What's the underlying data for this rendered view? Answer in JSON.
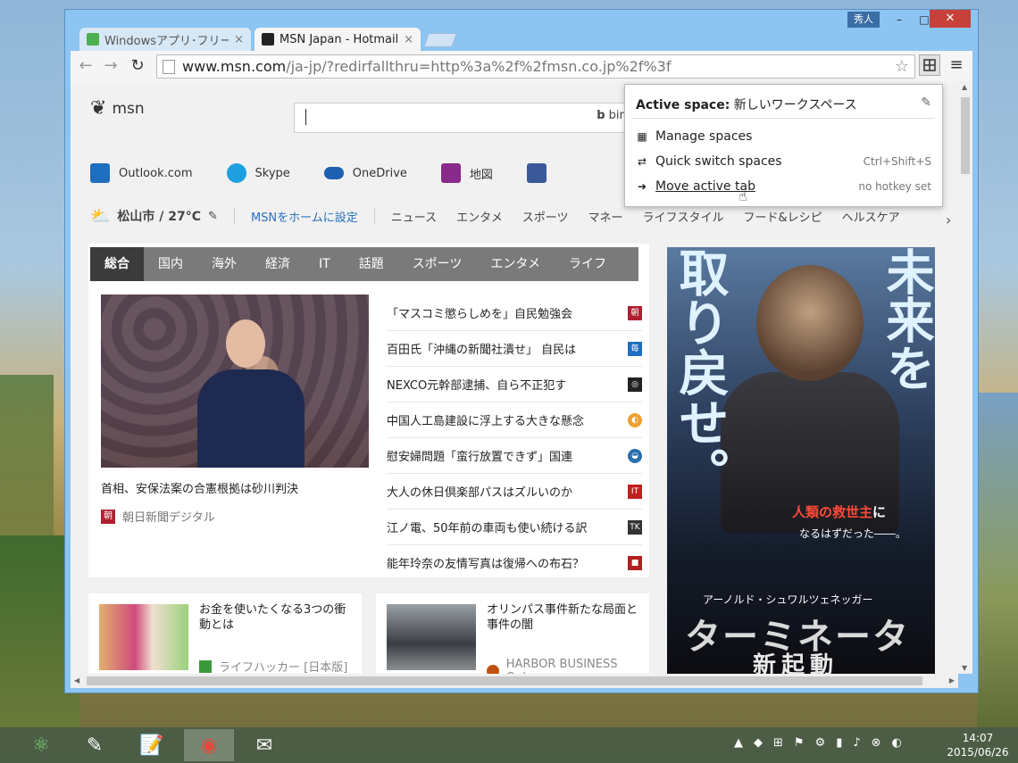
{
  "window": {
    "user_label": "秀人",
    "min_label": "–",
    "max_label": "□",
    "close_label": "✕"
  },
  "tabs": [
    {
      "title": "Windowsアプリ･フリーソフト",
      "close": "×",
      "active": false
    },
    {
      "title": "MSN Japan - Hotmail, C",
      "close": "×",
      "active": true
    }
  ],
  "toolbar": {
    "back_icon": "←",
    "forward_icon": "→",
    "reload_icon": "↻",
    "url_host": "www.msn.com",
    "url_rest": "/ja-jp/?redirfallthru=http%3a%2f%2fmsn.co.jp%2f%3f",
    "star_icon": "☆",
    "menu_icon": "≡"
  },
  "msn": {
    "logo_text": "msn",
    "bing_label": "bing",
    "quick_links": [
      {
        "label": "Outlook.com",
        "color": "#1e6fbf"
      },
      {
        "label": "Skype",
        "color": "#1ea0e0"
      },
      {
        "label": "OneDrive",
        "color": "#1d5fb0"
      },
      {
        "label": "地図",
        "color": "#8a2a8a"
      }
    ],
    "weather_city": "松山市 / 27°C",
    "set_home": "MSNをホームに設定",
    "nav_items": [
      "ニュース",
      "エンタメ",
      "スポーツ",
      "マネー",
      "ライフスタイル",
      "フード&レシピ",
      "ヘルスケア"
    ],
    "categories": [
      "総合",
      "国内",
      "海外",
      "経済",
      "IT",
      "話題",
      "スポーツ",
      "エンタメ",
      "ライフ"
    ],
    "main_headline": "首相、安保法案の合憲根拠は砂川判決",
    "main_source": "朝日新聞デジタル",
    "main_source_icon": "朝",
    "news": [
      {
        "title": "「マスコミ懲らしめを」自民勉強会",
        "icon": "朝",
        "color": "#b02030"
      },
      {
        "title": "百田氏「沖縄の新聞社潰せ」 自民は",
        "icon": "毎",
        "color": "#1e6fbf"
      },
      {
        "title": "NEXCO元幹部逮捕、自ら不正犯す",
        "icon": "◎",
        "color": "#222222"
      },
      {
        "title": "中国人工島建設に浮上する大きな懸念",
        "icon": "◐",
        "color": "#f0a030"
      },
      {
        "title": "慰安婦問題「蛮行放置できず」国連",
        "icon": "◒",
        "color": "#2a6fb0"
      },
      {
        "title": "大人の休日倶楽部パスはズルいのか",
        "icon": "IT",
        "color": "#c02020"
      },
      {
        "title": "江ノ電、50年前の車両も使い続ける訳",
        "icon": "TK",
        "color": "#333333"
      },
      {
        "title": "能年玲奈の友情写真は復帰への布石？",
        "icon": "■",
        "color": "#b02020"
      }
    ],
    "cards": [
      {
        "title": "お金を使いたくなる3つの衝動とは",
        "source": "ライフハッカー [日本版]",
        "icon_color": "#3a9a3a"
      },
      {
        "title": "オリンパス事件新たな局面と事件の闇",
        "source": "HARBOR BUSINESS Onl...",
        "icon_color": "#c05010"
      }
    ],
    "ad": {
      "left_text": "取り戻せ。",
      "right_text": "未来を",
      "tagline_red": "人類の救世主",
      "tagline_suffix": "に",
      "tagline2": "なるはずだった――。",
      "actor": "アーノルド・シュワルツェネッガー",
      "title": "ターミネーター",
      "subtitle": "新起動"
    }
  },
  "popup": {
    "header_bold": "Active space:",
    "header_value": "新しいワークスペース",
    "items": [
      {
        "label": "Manage spaces",
        "hotkey": ""
      },
      {
        "label": "Quick switch spaces",
        "hotkey": "Ctrl+Shift+S"
      },
      {
        "label": "Move active tab",
        "hotkey": "no hotkey set"
      }
    ]
  },
  "taskbar": {
    "time": "14:07",
    "date": "2015/06/26"
  }
}
